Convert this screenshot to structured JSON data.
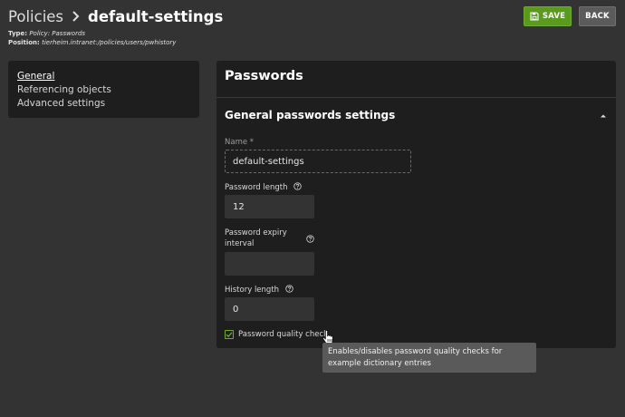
{
  "header": {
    "breadcrumb": "Policies",
    "title": "default-settings",
    "type_label": "Type:",
    "type_value": "Policy: Passwords",
    "position_label": "Position:",
    "position_value": "tierheim.intranet:/policies/users/pwhistory"
  },
  "toolbar": {
    "save_label": "SAVE",
    "back_label": "BACK"
  },
  "nav": {
    "items": [
      {
        "label": "General"
      },
      {
        "label": "Referencing objects"
      },
      {
        "label": "Advanced settings"
      }
    ]
  },
  "panel": {
    "title": "Passwords",
    "section_title": "General passwords settings",
    "fields": {
      "name": {
        "label": "Name *",
        "value": "default-settings"
      },
      "password_length": {
        "label": "Password length",
        "value": "12"
      },
      "expiry_interval": {
        "label_line1": "Password expiry",
        "label_line2": "interval",
        "value": ""
      },
      "history_length": {
        "label": "History length",
        "value": "0"
      }
    },
    "quality_check": {
      "label": "Password quality check",
      "checked": true
    }
  },
  "tooltip": {
    "text": "Enables/disables password quality checks for example dictionary entries"
  },
  "colors": {
    "accent": "#5a9a1f",
    "panel_bg": "#1e1e1e",
    "page_bg": "#333333"
  },
  "icons": [
    "chevron-right-icon",
    "floppy-disk-icon",
    "chevron-up-icon",
    "help-circle-icon",
    "checkmark-icon",
    "hand-pointer-icon"
  ]
}
